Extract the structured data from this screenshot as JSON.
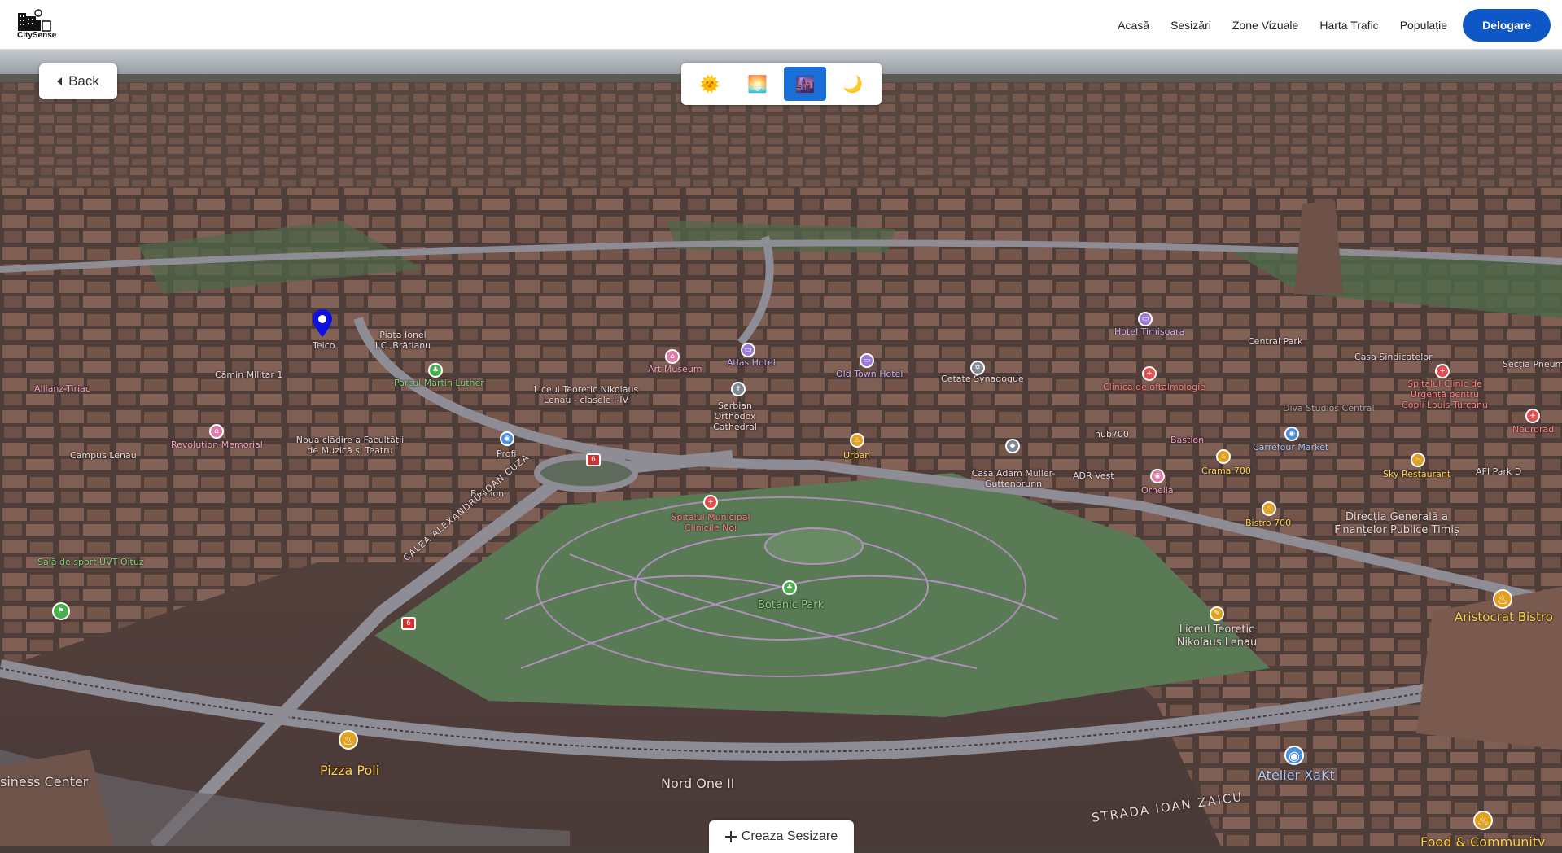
{
  "navbar": {
    "brand": "CitySense",
    "links": [
      "Acasă",
      "Sesizări",
      "Zone Vizuale",
      "Harta Trafic",
      "Populație"
    ],
    "logout": "Delogare"
  },
  "controls": {
    "back": "Back",
    "time_of_day": [
      {
        "name": "day",
        "icon": "🌞"
      },
      {
        "name": "dawn",
        "icon": "🌅"
      },
      {
        "name": "dusk",
        "icon": "🌆",
        "active": true
      },
      {
        "name": "night",
        "icon": "🌙"
      }
    ],
    "create_report": "Creaza Sesizare"
  },
  "map": {
    "labels": {
      "telco": "Telco",
      "plata": "Piața Ionel I.C. Brătianu",
      "parcul": "Parcul Martin Luther",
      "camin": "Cămin Militar 1",
      "allianz": "Allianz-Tiriac",
      "revolution": "Revolution Memorial",
      "campus": "Campus Lenau",
      "noua": "Noua clădire a Facultății de Muzică și Teatru",
      "profi": "Profi",
      "bastion1": "Bastion",
      "sala": "Sală de sport UVT Oituz",
      "calea": "CALEA ALEXANDRU IOAN CUZA",
      "art": "Art Museum",
      "atlas": "Atlas Hotel",
      "liceu_nikolaus": "Liceul Teoretic Nikolaus Lenau - clasele I-IV",
      "serbian": "Serbian Orthodox Cathedral",
      "old_town": "Old Town Hotel",
      "urban": "Urban",
      "spitalul": "Spitalul Municipal Clinicile Noi",
      "botanic": "Botanic Park",
      "cetate": "Cetate Synagogue",
      "hotel_tim": "Hotel Timișoara",
      "clinica": "Clinica de oftalmologie",
      "hub": "hub700",
      "bastion2": "Bastion",
      "casa_adam": "Casa Adam Müller-Guttenbrunn",
      "adr": "ADR Vest",
      "ornella": "Ornella",
      "crama": "Crama 700",
      "bistro": "Bistro 700",
      "central_park": "Central Park",
      "casa_sind": "Casa Sindicatelor",
      "spitalul_clinic": "Spitalul Clinic de Urgență pentru Copii Louis Turcanu",
      "diva": "Diva Studios Central",
      "carrefour": "Carrefour Market",
      "sky": "Sky Restaurant",
      "afi": "AFI Park D",
      "directia": "Direcția Generală a Finanțelor Publice Timiș",
      "neurorad": "Neurorad",
      "sectia": "Secția Pneumo",
      "liceul_teoretic": "Liceul Teoretic Nikolaus Lenau",
      "aristocrat": "Aristocrat Bistro",
      "strada": "STRADA IOAN ZAICU",
      "atelier": "Atelier XaKt",
      "pizza": "Pizza Poli",
      "nord": "Nord One II",
      "business": "siness Center",
      "food": "Food & Community"
    }
  }
}
